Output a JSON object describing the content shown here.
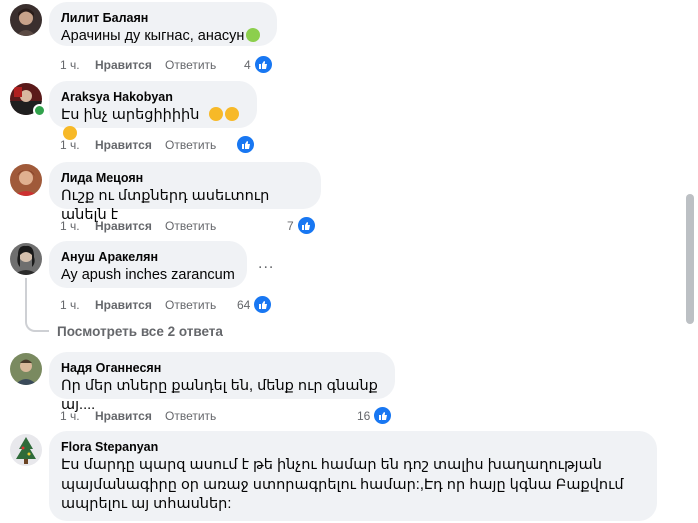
{
  "colors": {
    "bubble": "#f0f2f5",
    "meta": "#65676b",
    "like_blue": "#1877f2"
  },
  "actions": {
    "like": "Нравится",
    "reply": "Ответить"
  },
  "comments": [
    {
      "author": "Лилит Балаян",
      "text": "Арачины ду кыгнас, анасун",
      "emoji": "nauseated-face",
      "time": "1 ч.",
      "likes": "4"
    },
    {
      "author": "Araksya Hakobyan",
      "text": "Էս ինչ արեցիիիին",
      "emoji": "crying-face x3",
      "time": "1 ч.",
      "likes": ""
    },
    {
      "author": "Лида Мецоян",
      "text": "Ուշք ու մտքներդ ասեւտուր անելն է",
      "time": "1 ч.",
      "likes": "7"
    },
    {
      "author": "Ануш Аракелян",
      "text": "Ay apush inches zarancum",
      "time": "1 ч.",
      "likes": "64"
    },
    {
      "author": "Надя Оганнесян",
      "text": "Որ մեր տները քանդել են, մենք ուր գնանք այ....",
      "time": "1 ч.",
      "likes": "16"
    },
    {
      "author": "Flora Stepanyan",
      "text": "Էս մարդը պարզ ասում է թե ինչու համար են դոշ տալիս խաղաղության պայմանագիրը օր առաջ ստորագրելու համար:,Էդ որ հայը կգնա Բաքվում ապրելու այ տհասներ:"
    }
  ],
  "see_replies": "Посмотреть все 2 ответа",
  "more_menu": "..."
}
